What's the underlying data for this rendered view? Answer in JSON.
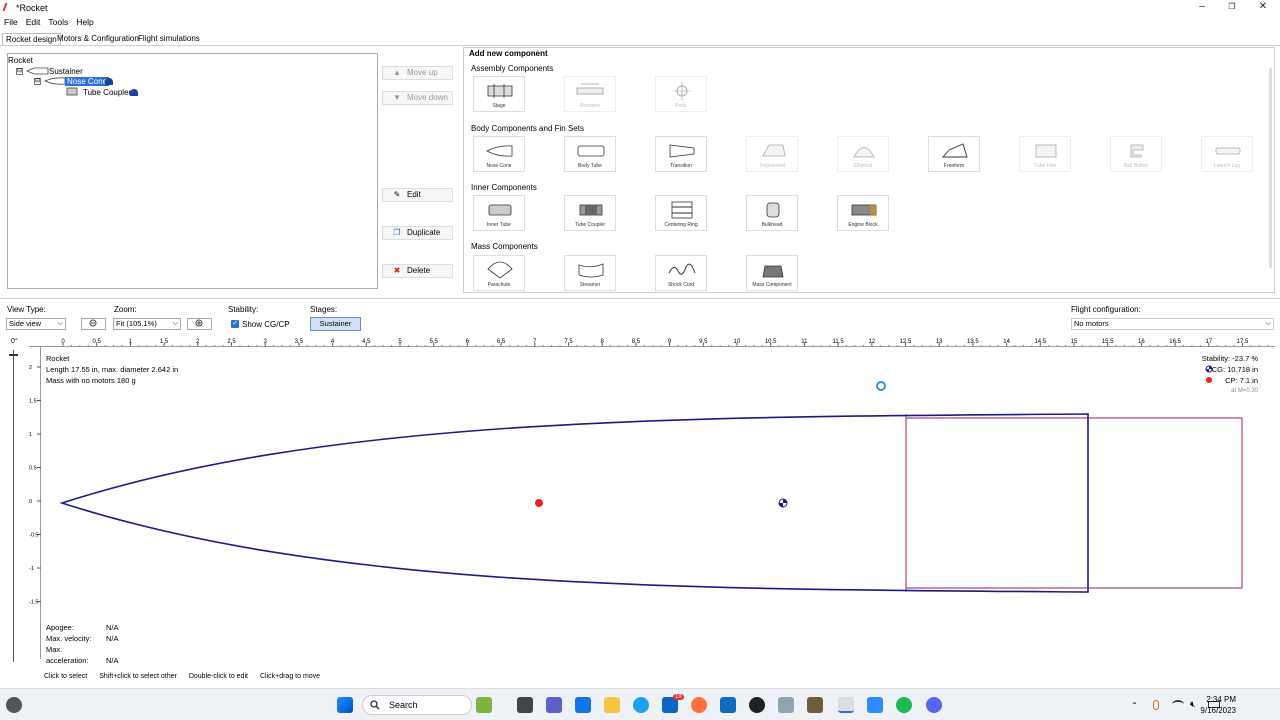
{
  "window": {
    "title": "*Rocket",
    "controls": {
      "minimize": "–",
      "maximize": "❐",
      "close": "✕"
    }
  },
  "menu": [
    "File",
    "Edit",
    "Tools",
    "Help"
  ],
  "tabs": [
    "Rocket design",
    "Motors & Configuration",
    "Flight simulations"
  ],
  "tree": {
    "root": "Rocket",
    "sustainer": "Sustainer",
    "nose_cone": "Nose Cone",
    "tube_coupler": "Tube Coupler",
    "expanders": [
      "⊟",
      "⊟"
    ]
  },
  "side_buttons": {
    "move_up": "Move up",
    "move_down": "Move down",
    "edit": "Edit",
    "duplicate": "Duplicate",
    "delete": "Delete",
    "icons": {
      "move_up": "▲",
      "move_down": "▼",
      "edit": "✎",
      "duplicate": "❐",
      "delete": "✖"
    }
  },
  "add_panel": {
    "title": "Add new component",
    "sections": [
      {
        "name": "Assembly Components",
        "items": [
          {
            "label": "Stage",
            "enabled": true
          },
          {
            "label": "Boosters",
            "enabled": false
          },
          {
            "label": "Pods",
            "enabled": false
          }
        ]
      },
      {
        "name": "Body Components and Fin Sets",
        "items": [
          {
            "label": "Nose Cone",
            "enabled": true
          },
          {
            "label": "Body Tube",
            "enabled": true
          },
          {
            "label": "Transition",
            "enabled": true
          },
          {
            "label": "Trapezoidal",
            "enabled": false
          },
          {
            "label": "Elliptical",
            "enabled": false
          },
          {
            "label": "Freeform",
            "enabled": true
          },
          {
            "label": "Tube Fins",
            "enabled": false
          },
          {
            "label": "Rail Button",
            "enabled": false
          },
          {
            "label": "Launch Lug",
            "enabled": false
          }
        ]
      },
      {
        "name": "Inner Components",
        "items": [
          {
            "label": "Inner Tube",
            "enabled": true
          },
          {
            "label": "Tube Coupler",
            "enabled": true
          },
          {
            "label": "Centering Ring",
            "enabled": true
          },
          {
            "label": "Bulkhead",
            "enabled": true
          },
          {
            "label": "Engine Block",
            "enabled": true
          }
        ]
      },
      {
        "name": "Mass Components",
        "items": [
          {
            "label": "Parachute",
            "enabled": true
          },
          {
            "label": "Streamer",
            "enabled": true
          },
          {
            "label": "Shock Cord",
            "enabled": true
          },
          {
            "label": "Mass Component",
            "enabled": true
          }
        ]
      }
    ]
  },
  "view_controls": {
    "view_type_label": "View Type:",
    "view_type_value": "Side view",
    "zoom_label": "Zoom:",
    "zoom_value": "Fit (105.1%)",
    "stability_label": "Stability:",
    "show_cgcp": "Show CG/CP",
    "stages_label": "Stages:",
    "stage_button": "Sustainer",
    "flight_config_label": "Flight configuration:",
    "flight_config_value": "No motors",
    "angle": "0°",
    "dropdown": "⌵"
  },
  "rulers": {
    "x_ticks": [
      "0",
      "0.5",
      "1",
      "1.5",
      "2",
      "2.5",
      "3",
      "3.5",
      "4",
      "4.5",
      "5",
      "5.5",
      "6",
      "6.5",
      "7",
      "7.5",
      "8",
      "8.5",
      "9",
      "9.5",
      "10",
      "10.5",
      "11",
      "11.5",
      "12",
      "12.5",
      "13",
      "13.5",
      "14",
      "14.5",
      "15",
      "15.5",
      "16",
      "16.5",
      "17",
      "17.5"
    ],
    "y_ticks": [
      "2",
      "1.5",
      "1",
      "0.5",
      "0",
      "-0.5",
      "-1",
      "-1.5"
    ]
  },
  "rocket_info": {
    "name": "Rocket",
    "length_line": "Length 17.55 in, max. diameter 2.642 in",
    "mass_line": "Mass with no motors 180 g"
  },
  "stability_info": {
    "stability": "Stability:  -23.7 %",
    "cg": "CG: 10.718 in",
    "cp": "CP:   7.1 in",
    "mach": "at M=0.30"
  },
  "flight_info": {
    "apogee_label": "Apogee:",
    "apogee_value": "N/A",
    "velocity_label": "Max. velocity:",
    "velocity_value": "N/A",
    "accel_label": "Max. acceleration:",
    "accel_value": "N/A"
  },
  "status_hints": [
    "Click to select",
    "Shift+click to select other",
    "Double-click to edit",
    "Click+drag to move"
  ],
  "taskbar": {
    "search": "Search",
    "time": "2:34 PM",
    "date": "9/16/2023",
    "badge": "19"
  }
}
